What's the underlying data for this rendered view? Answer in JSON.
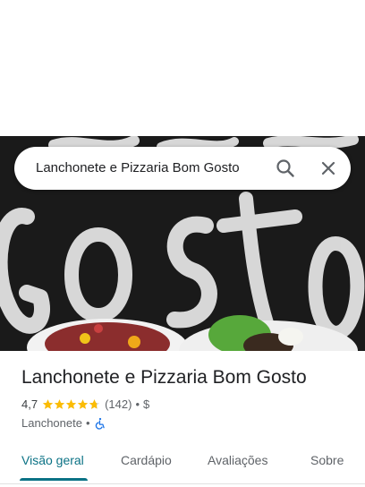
{
  "search": {
    "query": "Lanchonete e Pizzaria Bom Gosto",
    "search_icon": "search-icon",
    "clear_icon": "close-icon"
  },
  "place": {
    "name": "Lanchonete e Pizzaria Bom Gosto",
    "rating": "4,7",
    "stars": 4.7,
    "reviews": "(142)",
    "dot": "•",
    "price": "$",
    "category": "Lanchonete",
    "accessibility_icon": "wheelchair-icon"
  },
  "tabs": [
    {
      "label": "Visão geral",
      "active": true
    },
    {
      "label": "Cardápio",
      "active": false
    },
    {
      "label": "Avaliações",
      "active": false
    },
    {
      "label": "Sobre",
      "active": false
    }
  ],
  "colors": {
    "accent": "#0b7285",
    "star": "#fbbc04",
    "access": "#1a73e8"
  }
}
